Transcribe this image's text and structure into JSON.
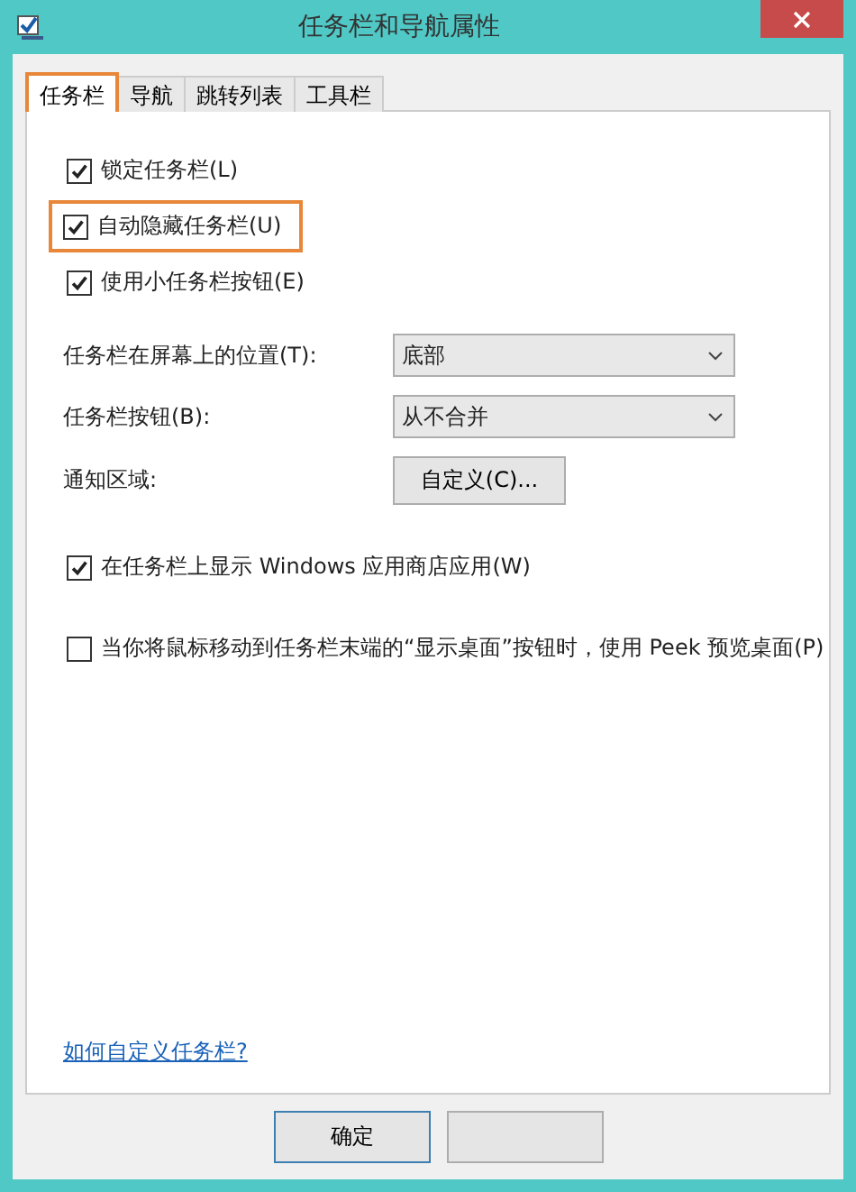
{
  "window": {
    "title": "任务栏和导航属性"
  },
  "tabs": [
    {
      "label": "任务栏",
      "selected": true,
      "highlighted": true
    },
    {
      "label": "导航",
      "selected": false,
      "highlighted": false
    },
    {
      "label": "跳转列表",
      "selected": false,
      "highlighted": false
    },
    {
      "label": "工具栏",
      "selected": false,
      "highlighted": false
    }
  ],
  "top_options": [
    {
      "label": "锁定任务栏(L)",
      "checked": true,
      "highlighted": false
    },
    {
      "label": "自动隐藏任务栏(U)",
      "checked": true,
      "highlighted": true
    },
    {
      "label": "使用小任务栏按钮(E)",
      "checked": true,
      "highlighted": false
    }
  ],
  "settings": [
    {
      "kind": "dropdown",
      "label": "任务栏在屏幕上的位置(T):",
      "value": "底部"
    },
    {
      "kind": "dropdown",
      "label": "任务栏按钮(B):",
      "value": "从不合并"
    },
    {
      "kind": "button",
      "label": "通知区域:",
      "value": "自定义(C)..."
    }
  ],
  "bottom_options": [
    {
      "label": "在任务栏上显示 Windows 应用商店应用(W)",
      "checked": true,
      "highlighted": false
    },
    {
      "label": "当你将鼠标移动到任务栏末端的“显示桌面”按钮时，使用 Peek 预览桌面(P)",
      "checked": false,
      "highlighted": false
    }
  ],
  "help_link": "如何自定义任务栏?",
  "buttons": [
    {
      "label": "确定",
      "default": true
    },
    {
      "default": false
    }
  ]
}
